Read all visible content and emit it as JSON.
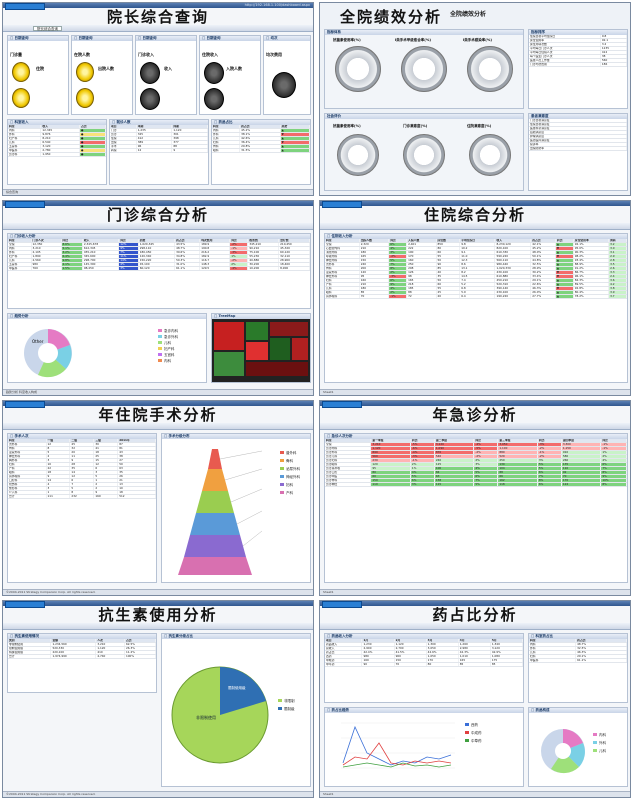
{
  "panels": {
    "p1": {
      "title": "院长综合查询",
      "tab": "院长综合查询",
      "footer": "综合查询",
      "labels": [
        "门诊量",
        "住院",
        "在院人数",
        "收入",
        "出院人数",
        "门诊收入",
        "住院收入",
        "药品占比",
        "均次费用",
        "入院人数"
      ]
    },
    "p2": {
      "title": "全院绩效分析",
      "subtitle": "全院绩效分析",
      "left_header": "指标体系",
      "right_header": "指标排序",
      "gauges": [
        "抗菌素使用率(%)",
        "I类手术甲级愈合率(%)",
        "I类手术感染率(%)",
        "抗菌素使用率(%)",
        "门诊满意度(%)",
        "住院满意度(%)"
      ],
      "mid_header": "社会评价",
      "list1": [
        "住院患者平均住院日",
        "床位使用率",
        "床位周转次数",
        "平均每日门诊人次",
        "平均每日住院人次",
        "每个医生门诊人次",
        "医技人员工作量",
        "门诊均次费用"
      ],
      "list2_header": "患者满意度",
      "list2": [
        "门诊患者满意度",
        "住院患者满意度",
        "医技科室满意度",
        "后勤满意度",
        "护理满意度",
        "医德医风满意度",
        "投诉率",
        "出院随访率"
      ]
    },
    "p3": {
      "title": "门诊综合分析",
      "footer": "趋势分析  科室收入构成",
      "pie_label": "Other"
    },
    "p4": {
      "title": "住院综合分析",
      "footer": "Sheet1"
    },
    "p5": {
      "title": "年住院手术分析",
      "year": "2011年"
    },
    "p6": {
      "title": "年急诊分析",
      "footer": "Sheet1"
    },
    "p7": {
      "title": "抗生素使用分析",
      "pie_center": "非限制使用",
      "pie_slice": "限制使用级"
    },
    "p8": {
      "title": "药占比分析",
      "footer": "Sheet1"
    }
  },
  "copyright": "©2004-2011 Strategy Companion Corp. All rights reserved.",
  "url": "http://192.168.1.100/dashboard.aspx",
  "colors": {
    "accent": "#2f568e",
    "red": "#f36b6b",
    "green": "#7ed37e",
    "yellow": "#f8e27a"
  }
}
